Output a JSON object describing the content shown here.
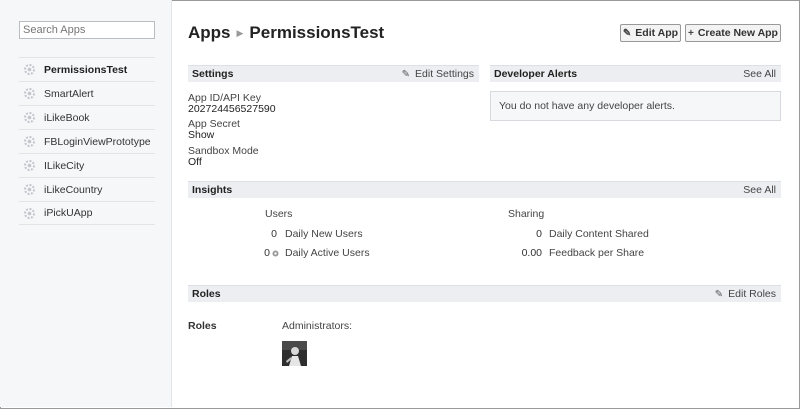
{
  "sidebar": {
    "search_placeholder": "Search Apps",
    "apps": [
      {
        "label": "PermissionsTest"
      },
      {
        "label": "SmartAlert"
      },
      {
        "label": "iLikeBook"
      },
      {
        "label": "FBLoginViewPrototype"
      },
      {
        "label": "ILikeCity"
      },
      {
        "label": "iLikeCountry"
      },
      {
        "label": "iPickUApp"
      }
    ]
  },
  "header": {
    "section": "Apps",
    "app_name": "PermissionsTest",
    "edit_app": "Edit App",
    "create_new_app": "Create New App"
  },
  "settings": {
    "title": "Settings",
    "edit_link": "Edit Settings",
    "app_id_label": "App ID/API Key",
    "app_id_value": "202724456527590",
    "app_secret_label": "App Secret",
    "app_secret_value": "Show",
    "sandbox_label": "Sandbox Mode",
    "sandbox_value": "Off"
  },
  "alerts": {
    "title": "Developer Alerts",
    "see_all": "See All",
    "empty_message": "You do not have any developer alerts."
  },
  "insights": {
    "title": "Insights",
    "see_all": "See All",
    "users_heading": "Users",
    "sharing_heading": "Sharing",
    "users": [
      {
        "value": "0",
        "label": "Daily New Users"
      },
      {
        "value": "0",
        "label": "Daily Active Users"
      }
    ],
    "sharing": [
      {
        "value": "0",
        "label": "Daily Content Shared"
      },
      {
        "value": "0.00",
        "label": "Feedback per Share"
      }
    ]
  },
  "roles": {
    "title": "Roles",
    "edit_link": "Edit Roles",
    "row_label": "Roles",
    "administrators_label": "Administrators:"
  },
  "colors": {
    "sidebar_bg": "#f6f7f9",
    "section_header_bg": "#eceef2",
    "button_bg": "#f3f3f3"
  }
}
